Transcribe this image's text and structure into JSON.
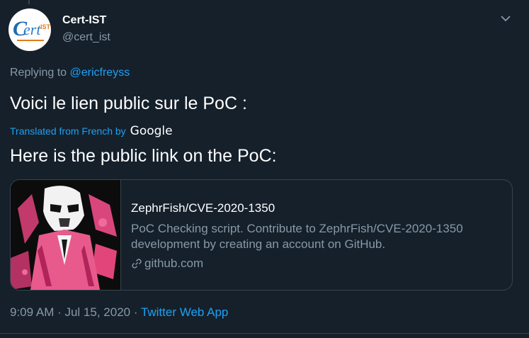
{
  "tweet": {
    "author": {
      "display_name": "Cert-IST",
      "handle": "@cert_ist",
      "avatar_logo": "cert-ist-logo"
    },
    "replying_to_label": "Replying to",
    "replying_to_handle": "@ericfreyss",
    "text": "Voici le lien public sur le PoC :",
    "translated_label": "Translated from French by",
    "translated_provider": "Google",
    "translation": "Here is the public link on the PoC:",
    "card": {
      "title": "ZephrFish/CVE-2020-1350",
      "description_line1": "PoC Checking script. Contribute to ZephrFish/CVE-2020-1350",
      "description_line2": "development by creating an account on GitHub.",
      "domain": "github.com",
      "link_icon": "link-icon"
    },
    "timestamp": "9:09 AM · Jul 15, 2020 ·",
    "source_app": "Twitter Web App"
  },
  "icons": {
    "caret": "chevron-down-icon"
  },
  "colors": {
    "background": "#15202b",
    "accent": "#1da1f2",
    "secondary_text": "#8899a6",
    "border": "#38444d",
    "card_art_pink": "#e2457a"
  }
}
